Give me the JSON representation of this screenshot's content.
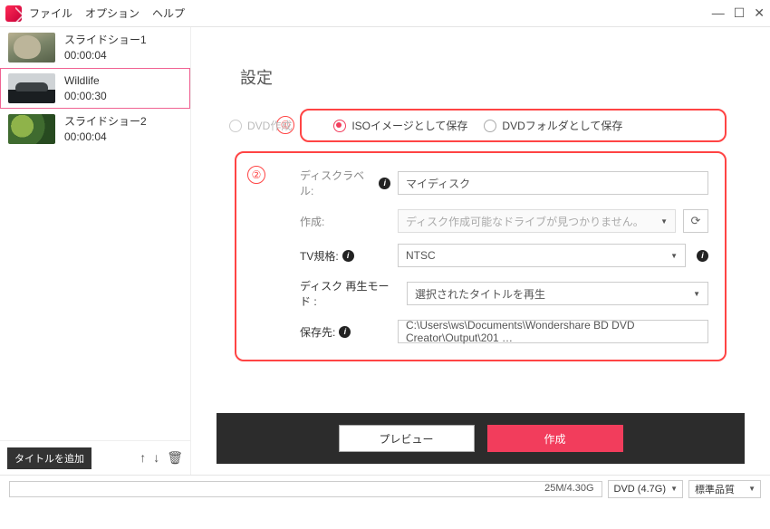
{
  "menu": {
    "file": "ファイル",
    "options": "オプション",
    "help": "ヘルプ"
  },
  "win": {
    "min": "—",
    "max": "☐",
    "close": "✕"
  },
  "clips": [
    {
      "title": "スライドショー1",
      "dur": "00:00:04"
    },
    {
      "title": "Wildlife",
      "dur": "00:00:30"
    },
    {
      "title": "スライドショー2",
      "dur": "00:00:04"
    }
  ],
  "sidebar": {
    "addTitle": "タイトルを追加",
    "up": "↑",
    "down": "↓",
    "delete": "🗑"
  },
  "settings": {
    "heading": "設定",
    "callout1": "①",
    "callout2": "②",
    "radios": {
      "dvd": "DVD作成",
      "iso": "ISOイメージとして保存",
      "folder": "DVDフォルダとして保存"
    },
    "labels": {
      "discLabel": "ディスクラベル:",
      "create": "作成:",
      "tv": "TV規格:",
      "playMode": "ディスク 再生モード :",
      "saveTo": "保存先:"
    },
    "values": {
      "discLabel": "マイディスク",
      "create": "ディスク作成可能なドライブが見つかりません。",
      "tv": "NTSC",
      "playMode": "選択されたタイトルを再生",
      "saveTo": "C:\\Users\\ws\\Documents\\Wondershare BD DVD Creator\\Output\\201 …"
    },
    "refreshIcon": "⟳"
  },
  "buttons": {
    "preview": "プレビュー",
    "create": "作成"
  },
  "status": {
    "progress": "25M/4.30G",
    "disc": "DVD (4.7G)",
    "quality": "標準品質"
  }
}
